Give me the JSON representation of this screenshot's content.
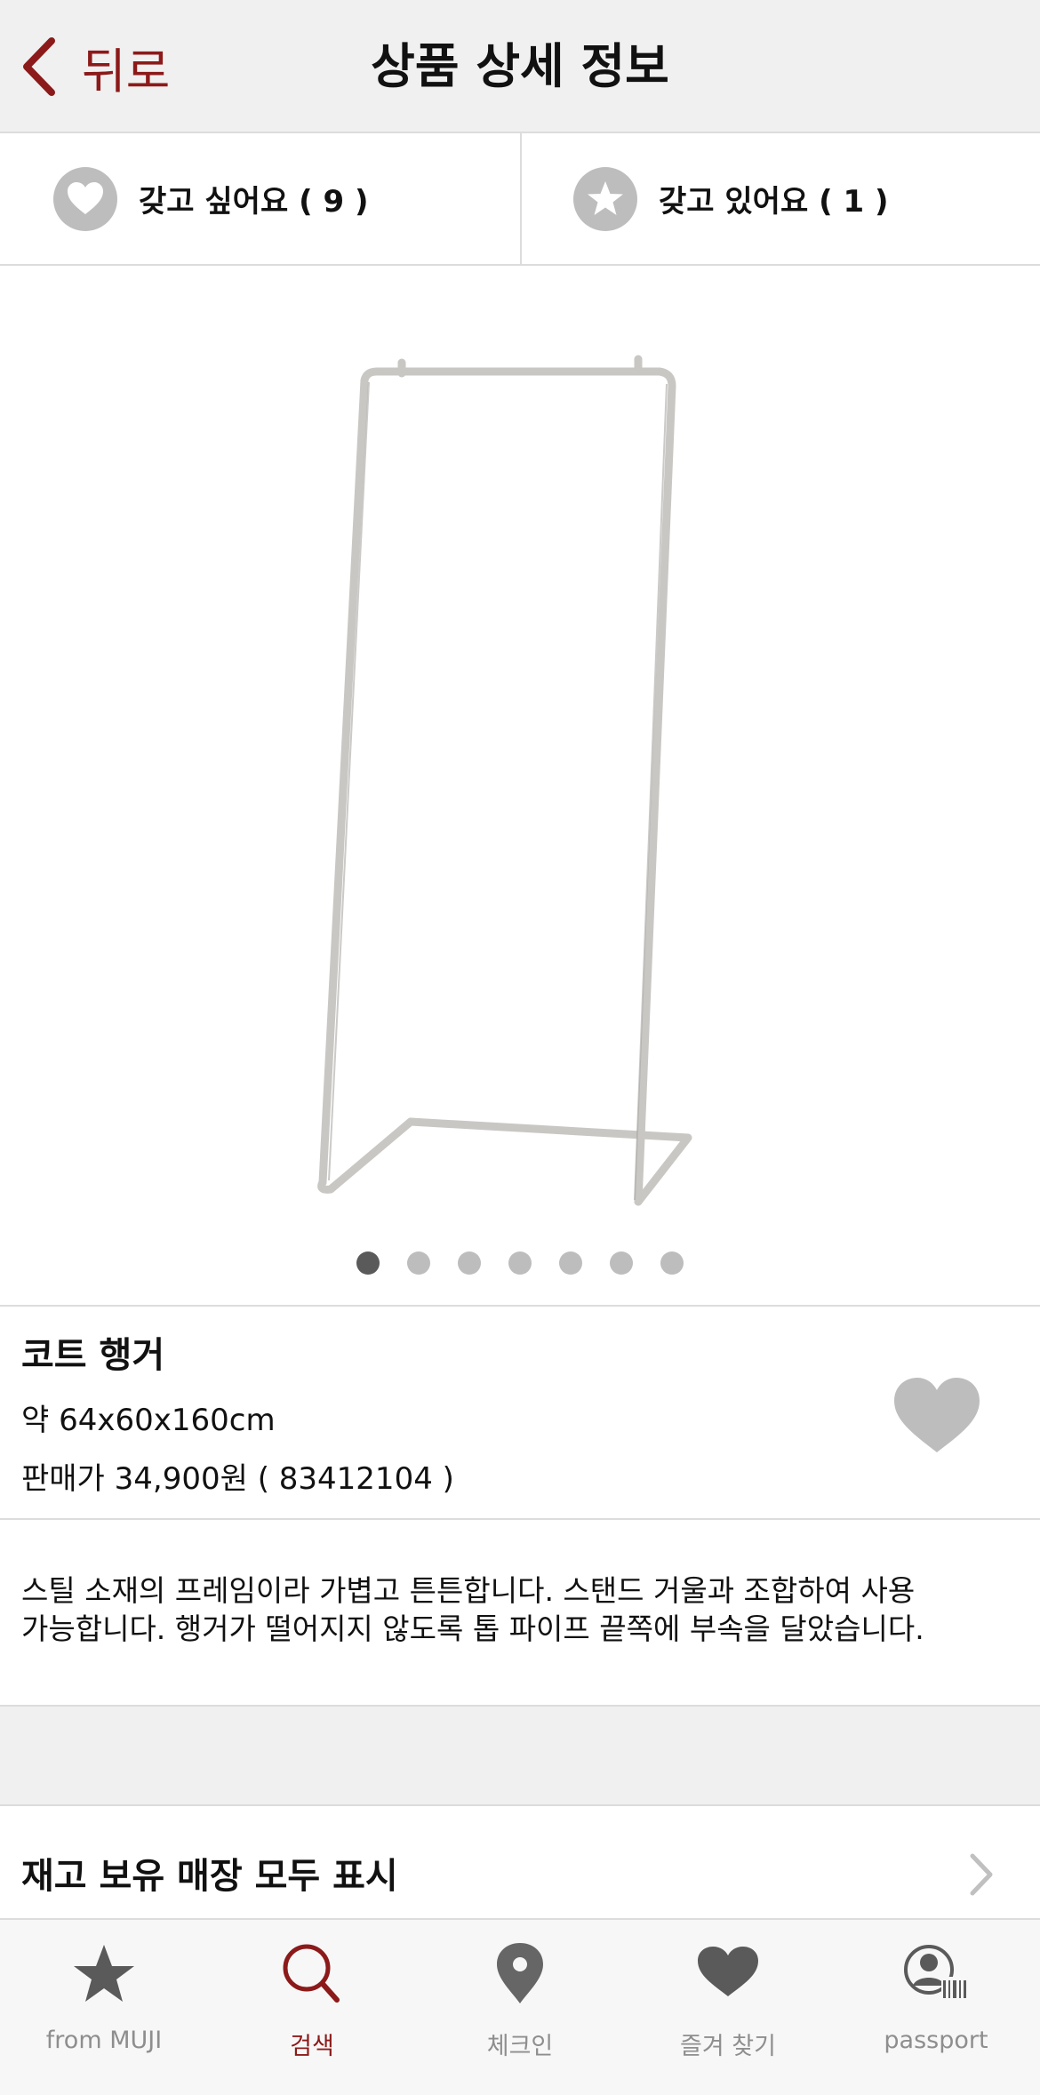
{
  "nav": {
    "back_label": "뒤로",
    "title": "상품 상세 정보"
  },
  "actions": {
    "want_label": "갖고 싶어요 ( 9 )",
    "have_label": "갖고 있어요 ( 1 )"
  },
  "carousel": {
    "count": 7,
    "active_index": 0
  },
  "product": {
    "name": "코트 행거",
    "size": "약 64x60x160cm",
    "price": "판매가 34,900원 ( 83412104 )",
    "description_line1": "스틸 소재의 프레임이라 가볍고 튼튼합니다. 스탠드 거울과 조합하여 사용",
    "description_line2": "가능합니다. 행거가 떨어지지 않도록 톱 파이프 끝쪽에 부속을 달았습니다."
  },
  "stores": {
    "label": "재고 보유 매장 모두 표시"
  },
  "tabbar": {
    "tabs": [
      {
        "label": "from MUJI",
        "icon": "star-icon"
      },
      {
        "label": "검색",
        "icon": "search-icon"
      },
      {
        "label": "체크인",
        "icon": "location-pin-icon"
      },
      {
        "label": "즐겨 찾기",
        "icon": "heart-icon"
      },
      {
        "label": "passport",
        "icon": "passport-icon"
      }
    ],
    "active_index": 1
  },
  "colors": {
    "accent": "#8c1a1a",
    "nav_bg": "#f0f0f0",
    "icon_gray": "#bdbdbd",
    "tab_inactive": "#8e8e8e",
    "divider": "#dcdcdc"
  }
}
